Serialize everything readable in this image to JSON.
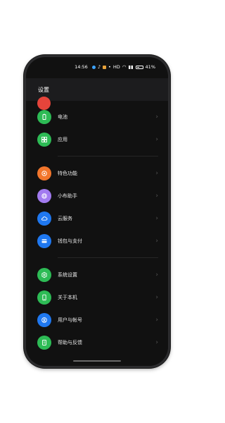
{
  "status_bar": {
    "time": "14:56",
    "battery": "41%",
    "signal_text": "HD"
  },
  "header": {
    "title": "设置"
  },
  "colors": {
    "green": "#2dbb55",
    "orange": "#f2762c",
    "purple": "#a27bf0",
    "blue": "#1f78f0",
    "red": "#e5443b"
  },
  "groups": [
    {
      "items": [
        {
          "label": "电池",
          "icon": "battery-icon"
        },
        {
          "label": "应用",
          "icon": "apps-grid-icon"
        }
      ]
    },
    {
      "items": [
        {
          "label": "特色功能",
          "icon": "star-features-icon"
        },
        {
          "label": "小布助手",
          "icon": "assistant-icon"
        },
        {
          "label": "云服务",
          "icon": "cloud-icon"
        },
        {
          "label": "钱包与支付",
          "icon": "wallet-icon"
        }
      ]
    },
    {
      "items": [
        {
          "label": "系统设置",
          "icon": "gear-icon"
        },
        {
          "label": "关于本机",
          "icon": "phone-icon"
        },
        {
          "label": "用户与帐号",
          "icon": "user-icon"
        },
        {
          "label": "帮助与反馈",
          "icon": "help-doc-icon"
        }
      ]
    }
  ]
}
